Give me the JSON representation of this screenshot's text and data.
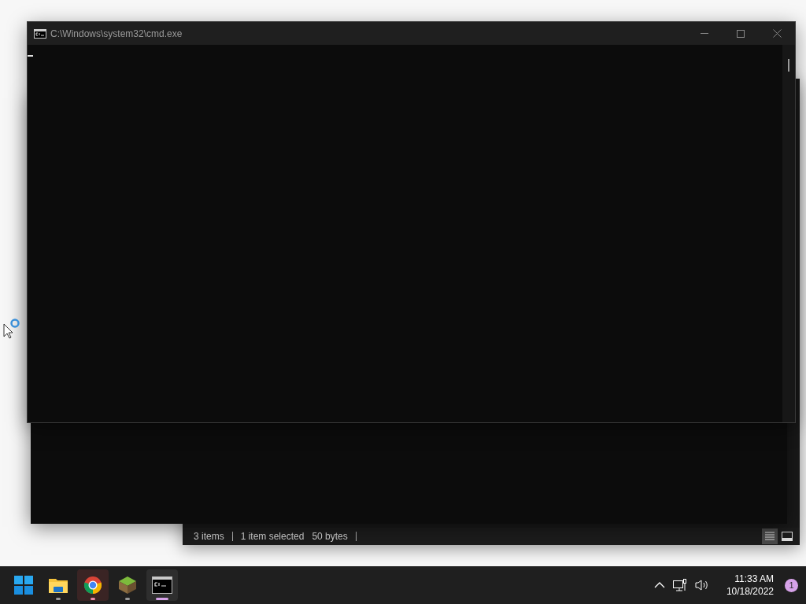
{
  "console_window": {
    "title": "C:\\Windows\\system32\\cmd.exe"
  },
  "explorer_window": {
    "status_bar": {
      "item_count": "3 items",
      "selection": "1 item selected",
      "size": "50 bytes"
    },
    "view_buttons": [
      {
        "kind": "details",
        "selected": true
      },
      {
        "kind": "preview",
        "selected": false
      }
    ]
  },
  "taskbar": {
    "apps": [
      {
        "kind": "start",
        "running": false,
        "attention": false,
        "selected": false
      },
      {
        "kind": "folder",
        "running": true,
        "attention": false,
        "selected": false
      },
      {
        "kind": "browser",
        "running": true,
        "attention": true,
        "selected": false
      },
      {
        "kind": "cube",
        "running": true,
        "attention": false,
        "selected": false
      },
      {
        "kind": "terminal",
        "running": true,
        "attention": false,
        "selected": true
      }
    ],
    "clock": {
      "time": "11:33 AM",
      "date": "10/18/2022"
    },
    "notifications": "1"
  }
}
